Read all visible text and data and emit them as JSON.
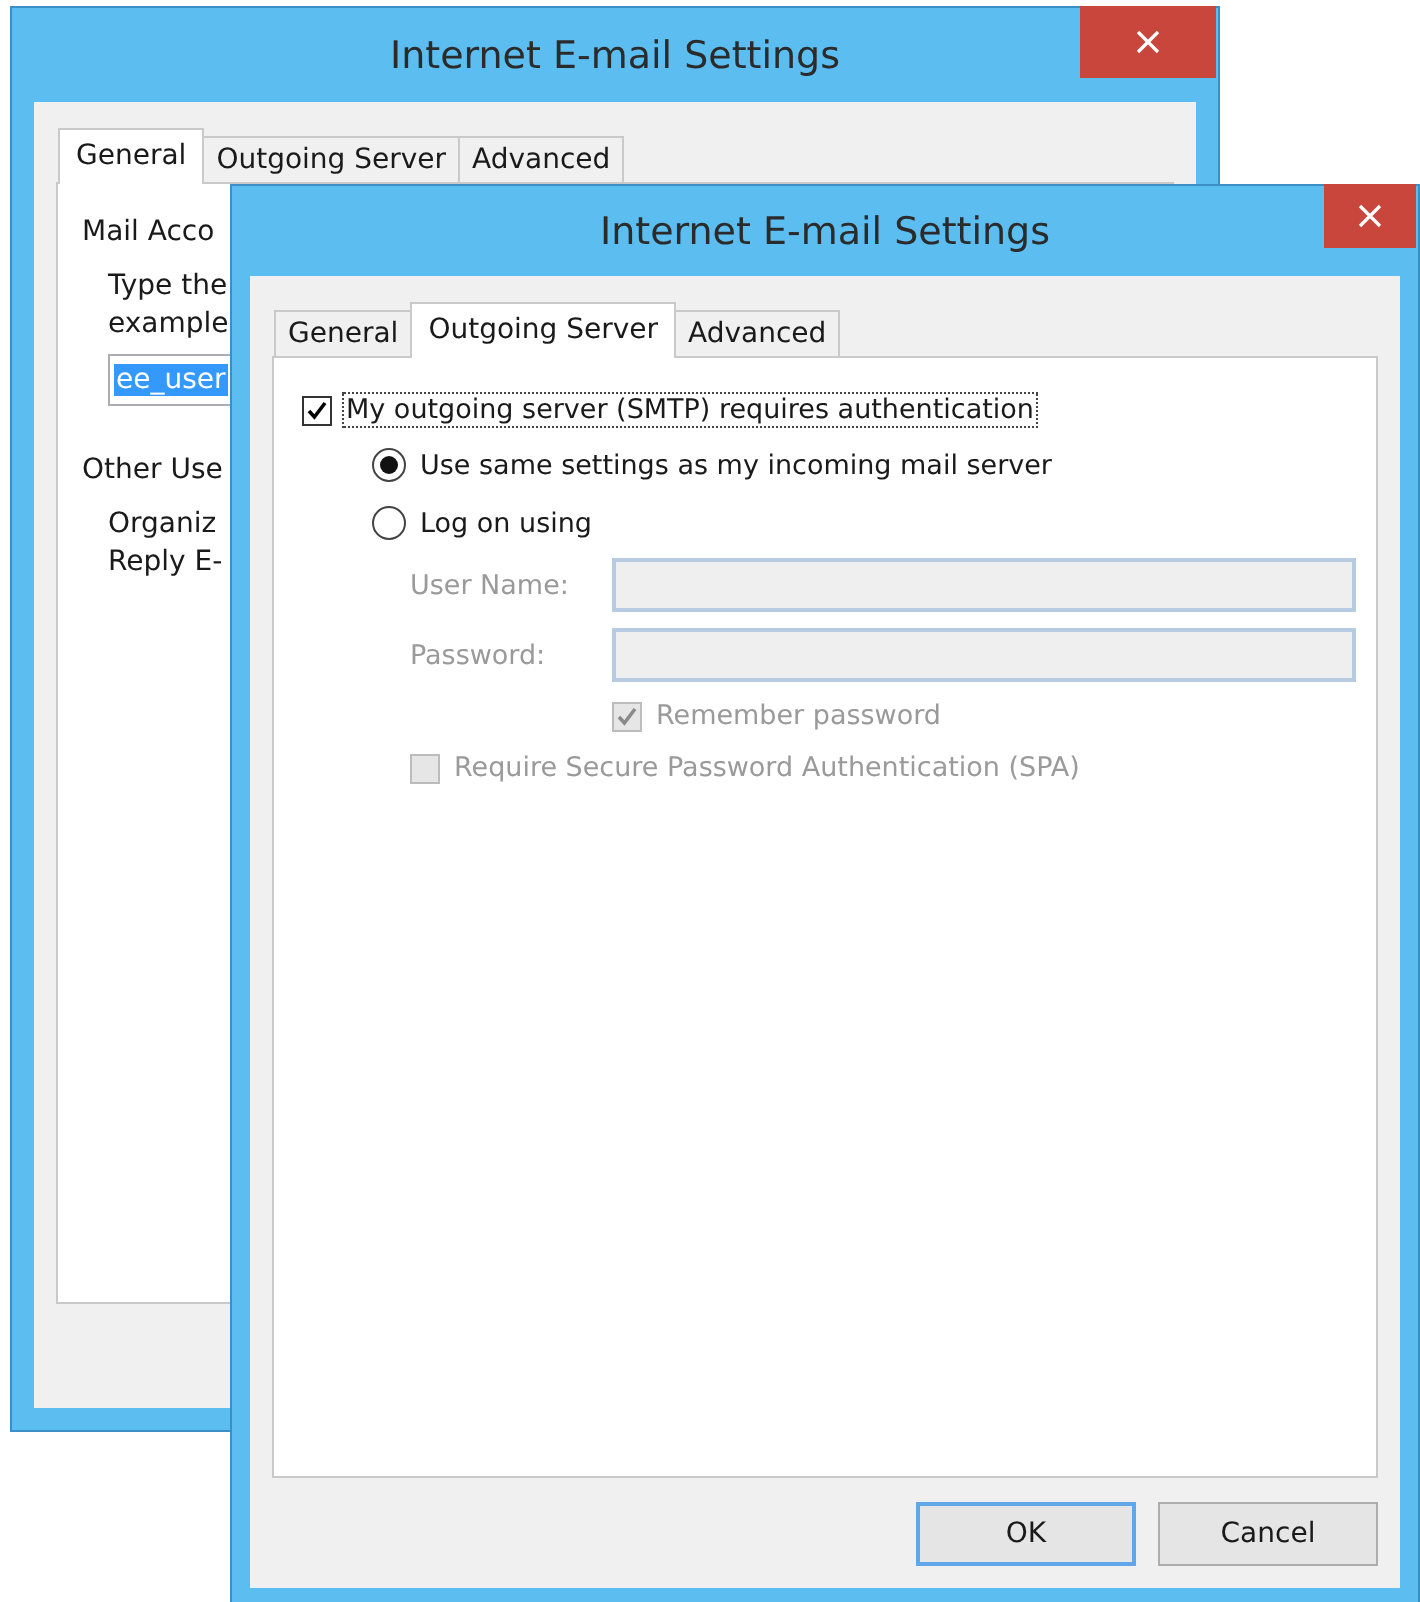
{
  "windows": [
    {
      "title": "Internet E-mail Settings",
      "tabs": [
        {
          "label": "General",
          "selected": true
        },
        {
          "label": "Outgoing Server",
          "selected": false
        },
        {
          "label": "Advanced",
          "selected": false
        }
      ],
      "sections": [
        {
          "heading": "Mail Acco",
          "children": [
            {
              "kind": "text",
              "text": "Type the"
            },
            {
              "kind": "text",
              "text": "example"
            },
            {
              "kind": "field",
              "value": "ee_user",
              "highlighted": true
            }
          ]
        },
        {
          "heading": "Other Use",
          "children": [
            {
              "kind": "text",
              "text": "Organiz"
            },
            {
              "kind": "text",
              "text": "Reply E-"
            }
          ]
        }
      ]
    },
    {
      "title": "Internet E-mail Settings",
      "tabs": [
        {
          "label": "General",
          "selected": false
        },
        {
          "label": "Outgoing Server",
          "selected": true
        },
        {
          "label": "Advanced",
          "selected": false
        }
      ],
      "auth": {
        "label": "My outgoing server (SMTP) requires authentication",
        "checked": true,
        "focused": true
      },
      "radios": [
        {
          "label": "Use same settings as my incoming mail server",
          "selected": true
        },
        {
          "label": "Log on using",
          "selected": false
        }
      ],
      "fields": [
        {
          "label": "User Name:",
          "disabled": true
        },
        {
          "label": "Password:",
          "disabled": true
        }
      ],
      "remember": {
        "label": "Remember password",
        "checked": true,
        "disabled": true
      },
      "spa": {
        "label": "Require Secure Password Authentication (SPA)",
        "checked": false,
        "disabled": true
      },
      "buttons": [
        {
          "label": "OK",
          "default": true
        },
        {
          "label": "Cancel",
          "default": false
        }
      ]
    }
  ]
}
